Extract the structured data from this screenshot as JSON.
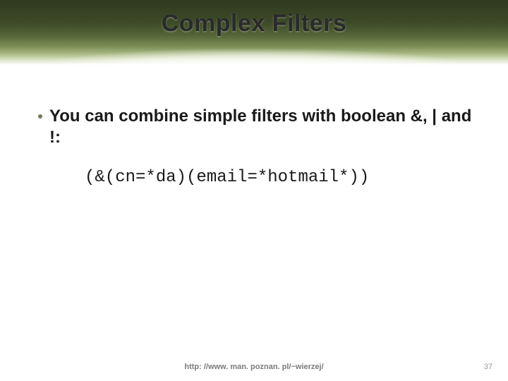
{
  "title": "Complex Filters",
  "bullet": "You can combine simple filters with boolean &, | and !:",
  "code": "(&(cn=*da)(email=*hotmail*))",
  "footer_url": "http: //www. man. poznan. pl/~wierzej/",
  "page_number": "37"
}
